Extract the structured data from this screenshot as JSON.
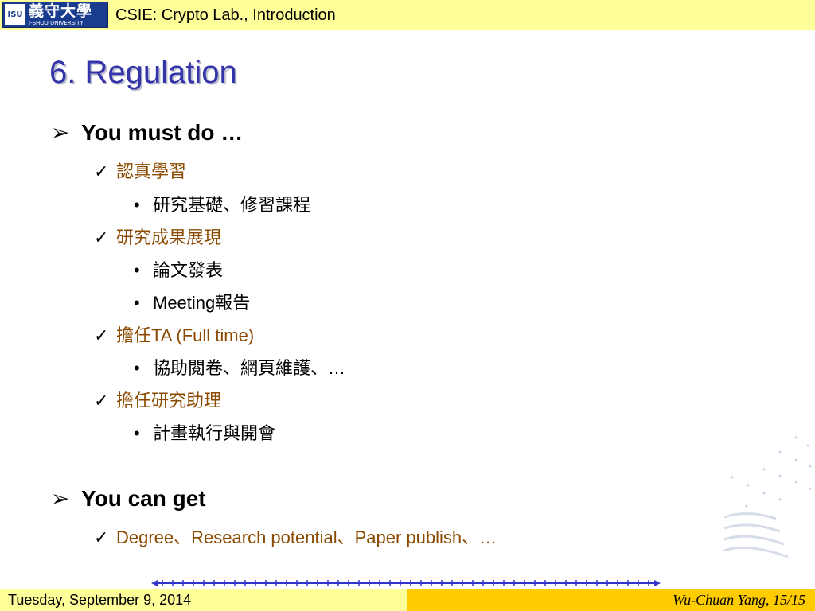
{
  "header": {
    "logo_chinese": "義守大學",
    "logo_english": "I-SHOU UNIVERSITY",
    "logo_emblem": "ISU",
    "title": "CSIE: Crypto Lab., Introduction"
  },
  "slide": {
    "title": "6. Regulation",
    "sections": [
      {
        "heading": "You must do …",
        "items": [
          {
            "label": "認真學習",
            "subitems": [
              "研究基礎、修習課程"
            ]
          },
          {
            "label": "研究成果展現",
            "subitems": [
              "論文發表",
              "Meeting報告"
            ]
          },
          {
            "label": "擔任TA (Full time)",
            "subitems": [
              "協助閱卷、網頁維護、…"
            ]
          },
          {
            "label": "擔任研究助理",
            "subitems": [
              "計畫執行與開會"
            ]
          }
        ]
      },
      {
        "heading": "You can get",
        "items": [
          {
            "label": "Degree、Research potential、Paper publish、…",
            "subitems": []
          }
        ]
      }
    ]
  },
  "footer": {
    "date": "Tuesday, September 9, 2014",
    "author_page": "Wu-Chuan Yang, 15/15"
  },
  "icons": {
    "level1": "arrow-right-icon",
    "level2": "checkmark-icon",
    "level3": "bullet-icon"
  },
  "colors": {
    "header_bg": "#ffff99",
    "footer_right_bg": "#ffcc00",
    "title_color": "#3333aa",
    "level2_color": "#8b4a00",
    "timeline_color": "#3333cc"
  }
}
